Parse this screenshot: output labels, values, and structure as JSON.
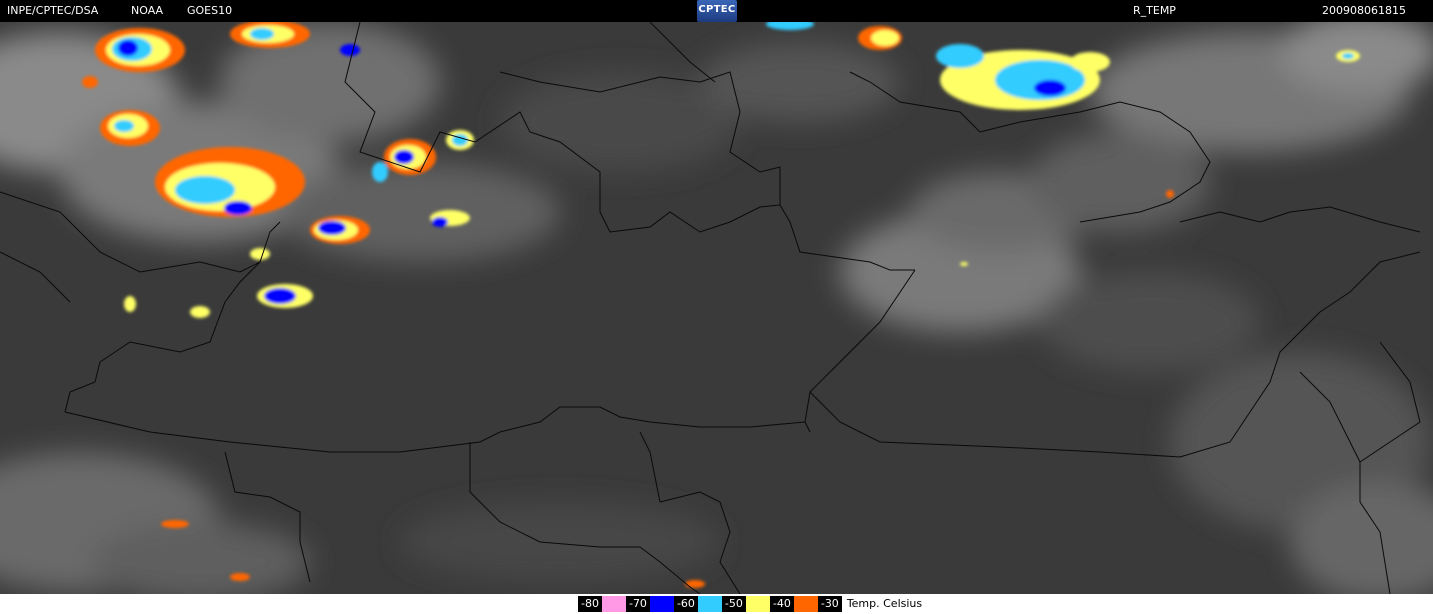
{
  "header": {
    "source": "INPE/CPTEC/DSA",
    "agency": "NOAA",
    "satellite": "GOES10",
    "logo": "CPTEC",
    "product": "R_TEMP",
    "timestamp": "200908061815"
  },
  "legend": {
    "items": [
      {
        "label": "-80",
        "color": "#ff99e6"
      },
      {
        "label": "-70",
        "color": "#0000ff"
      },
      {
        "label": "-60",
        "color": "#33ccff"
      },
      {
        "label": "-50",
        "color": "#ffff66"
      },
      {
        "label": "-40",
        "color": "#ff6600"
      },
      {
        "label": "-30",
        "color": null
      }
    ],
    "unit": "Temp. Celsius"
  },
  "colors": {
    "background": "#000000",
    "map_base": "#3c3c3c",
    "border_lines": "#000000"
  }
}
